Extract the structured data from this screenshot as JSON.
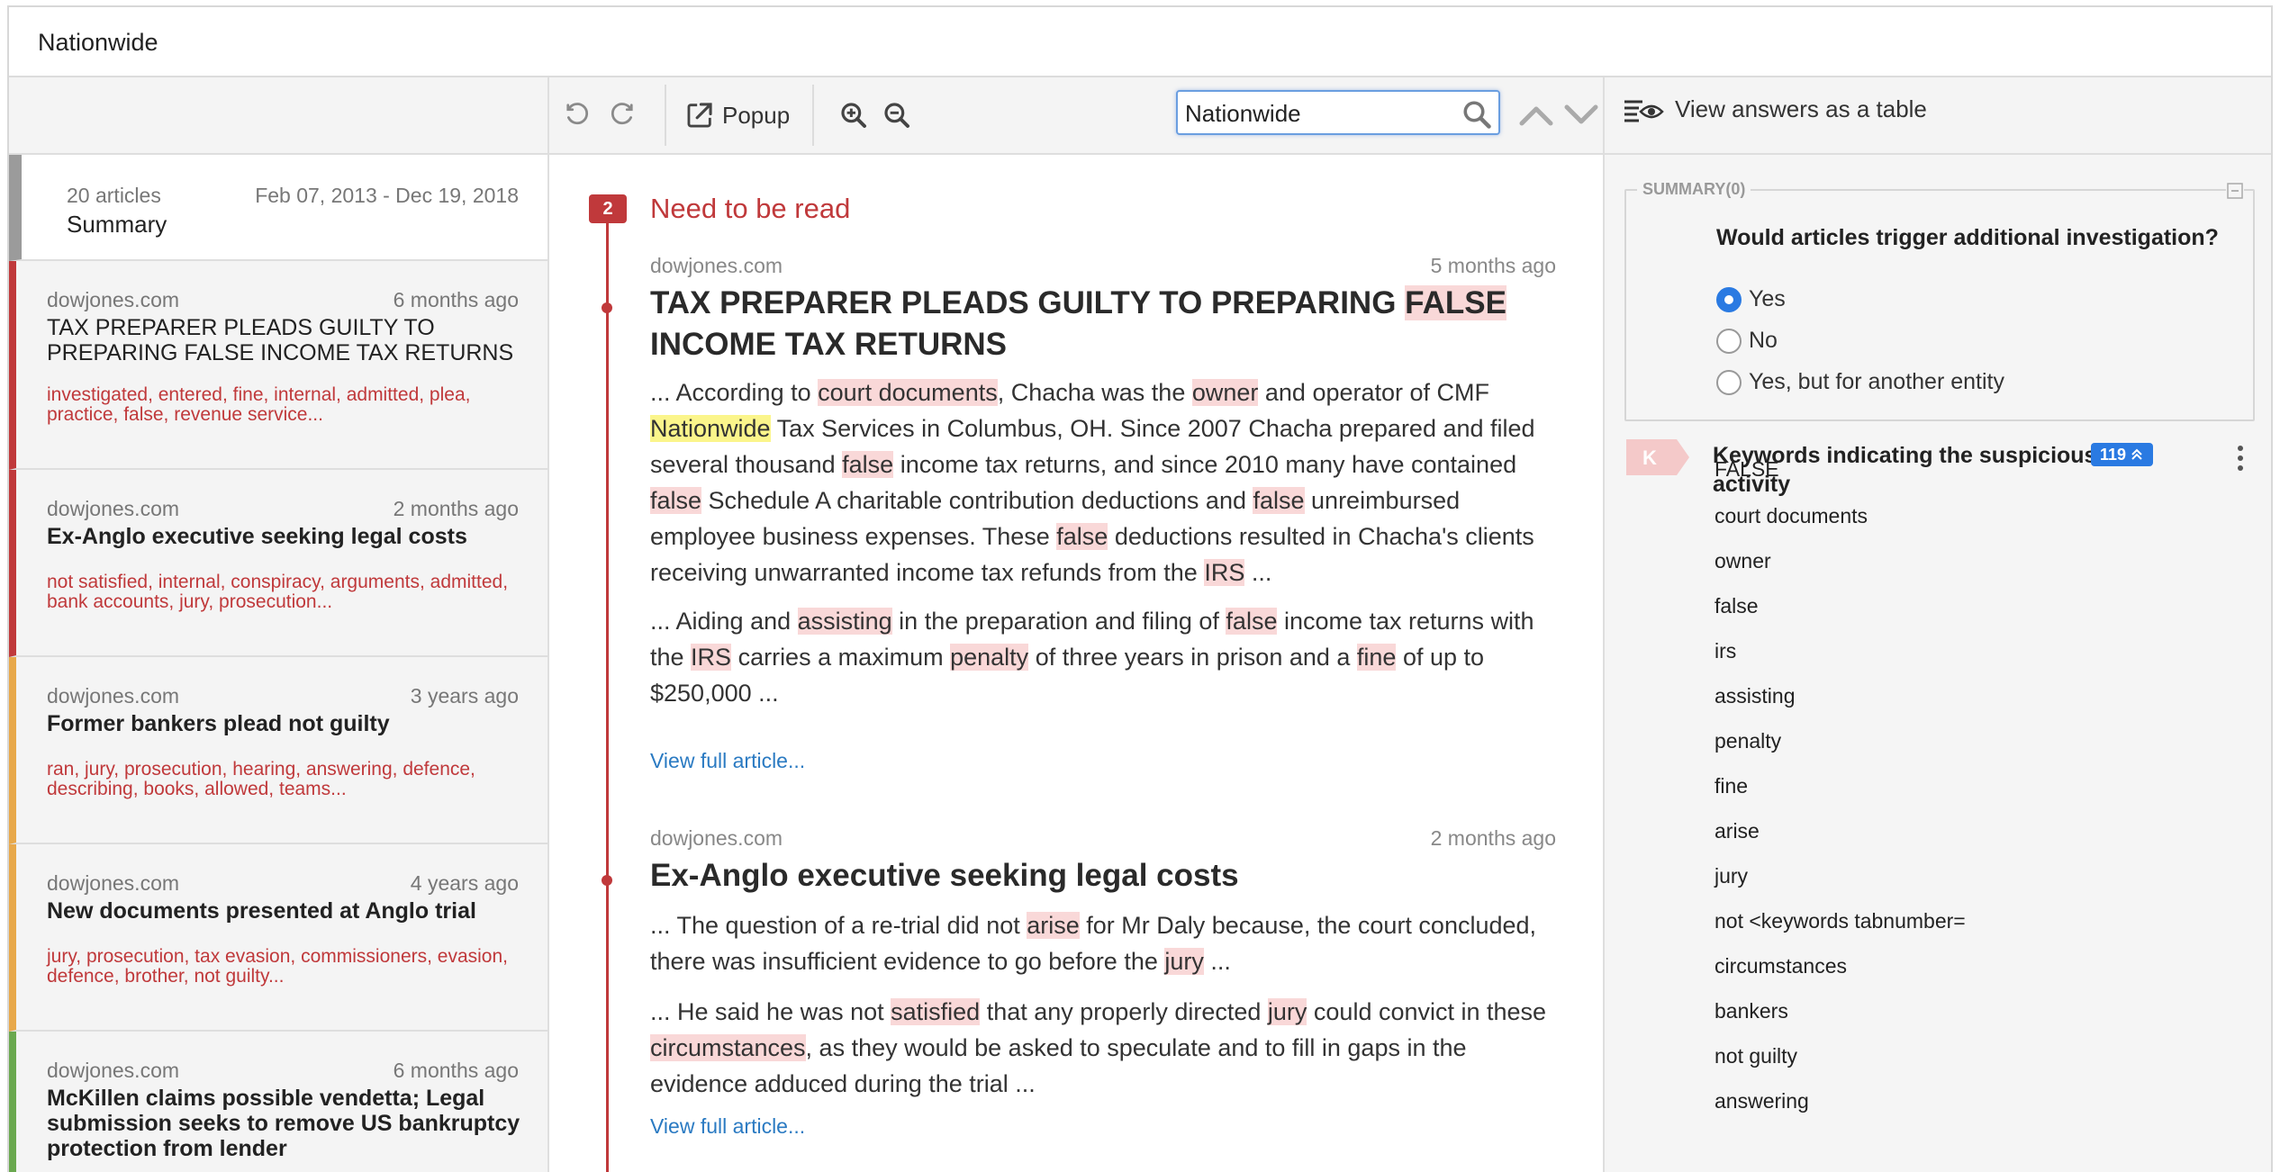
{
  "app": {
    "title": "Nationwide"
  },
  "toolbar": {
    "popup_label": "Popup",
    "search_value": "Nationwide",
    "view_table_label": "View answers as a table"
  },
  "summary": {
    "count": "20 articles",
    "range": "Feb 07, 2013 - Dec 19, 2018",
    "label": "Summary"
  },
  "articles_list": [
    {
      "source": "dowjones.com",
      "age": "6 months ago",
      "headline": "TAX PREPARER PLEADS GUILTY TO PREPARING FALSE INCOME TAX RETURNS",
      "keywords": "investigated, entered, fine, internal, admitted, plea, practice, false, revenue service...",
      "color": "#c0393b"
    },
    {
      "source": "dowjones.com",
      "age": "2 months ago",
      "headline": "Ex-Anglo executive seeking legal costs",
      "keywords": "not satisfied, internal, conspiracy, arguments, admitted, bank accounts, jury, prosecution...",
      "color": "#c0393b"
    },
    {
      "source": "dowjones.com",
      "age": "3 years ago",
      "headline": "Former bankers plead not guilty",
      "keywords": "ran, jury, prosecution, hearing, answering, defence, describing, books, allowed, teams...",
      "color": "#e8a84a"
    },
    {
      "source": "dowjones.com",
      "age": "4 years ago",
      "headline": "New documents presented at Anglo trial",
      "keywords": "jury, prosecution, tax evasion, commissioners, evasion, defence, brother, not guilty...",
      "color": "#e8a84a"
    },
    {
      "source": "dowjones.com",
      "age": "6 months ago",
      "headline": "McKillen claims possible vendetta; Legal submission seeks to remove US bankruptcy protection from lender",
      "keywords": "",
      "color": "#6aa84f"
    }
  ],
  "center": {
    "badge": "2",
    "section_label": "Need to be read",
    "articles": [
      {
        "source": "dowjones.com",
        "age": "5 months ago",
        "title_a": "TAX PREPARER PLEADS GUILTY TO PREPARING ",
        "title_hl": "FALSE",
        "title_b": " INCOME TAX RETURNS",
        "p1": [
          [
            "... According to ",
            ""
          ],
          [
            "court documents",
            "hl"
          ],
          [
            ", Chacha was the ",
            ""
          ],
          [
            "owner",
            "hl"
          ],
          [
            " and operator of CMF ",
            ""
          ],
          [
            "Nationwide",
            "hly"
          ],
          [
            " Tax Services in Columbus, OH. Since 2007 Chacha prepared and filed several thousand ",
            ""
          ],
          [
            "false",
            "hl"
          ],
          [
            " income tax returns, and since 2010 many have contained ",
            ""
          ],
          [
            "false",
            "hl"
          ],
          [
            " Schedule A charitable contribution deductions and ",
            ""
          ],
          [
            "false",
            "hl"
          ],
          [
            " unreimbursed employee business expenses. These ",
            ""
          ],
          [
            "false",
            "hl"
          ],
          [
            " deductions resulted in Chacha's clients receiving unwarranted income tax refunds from the ",
            ""
          ],
          [
            "IRS",
            "hl"
          ],
          [
            " ...",
            ""
          ]
        ],
        "p2": [
          [
            "... Aiding and ",
            ""
          ],
          [
            "assisting",
            "hl"
          ],
          [
            " in the preparation and filing of ",
            ""
          ],
          [
            "false",
            "hl"
          ],
          [
            " income tax returns with the ",
            ""
          ],
          [
            "IRS",
            "hl"
          ],
          [
            " carries a maximum ",
            ""
          ],
          [
            "penalty",
            "hl"
          ],
          [
            " of three years in prison and a ",
            ""
          ],
          [
            "fine",
            "hl"
          ],
          [
            " of up to $250,000 ...",
            ""
          ]
        ],
        "link": "View full article..."
      },
      {
        "source": "dowjones.com",
        "age": "2 months ago",
        "title_a": "Ex-Anglo executive seeking legal costs",
        "title_hl": "",
        "title_b": "",
        "p1": [
          [
            "... The question of a re-trial did not ",
            ""
          ],
          [
            "arise",
            "hl"
          ],
          [
            " for Mr Daly because, the court concluded, there was insufficient evidence to go before the ",
            ""
          ],
          [
            "jury",
            "hl"
          ],
          [
            " ...",
            ""
          ]
        ],
        "p2": [
          [
            "... He said he was not ",
            ""
          ],
          [
            "satisfied",
            "hl"
          ],
          [
            " that any properly directed ",
            ""
          ],
          [
            "jury",
            "hl"
          ],
          [
            " could convict in these ",
            ""
          ],
          [
            "circumstances",
            "hl"
          ],
          [
            ", as they would be asked to speculate and to fill in gaps in the evidence adduced during the trial ...",
            ""
          ]
        ],
        "link": "View full article..."
      }
    ]
  },
  "right": {
    "summary_legend": "SUMMARY(0)",
    "question": "Would articles trigger additional investigation?",
    "options": [
      "Yes",
      "No",
      "Yes, but for another entity"
    ],
    "selected_option": "Yes",
    "kw_tag": "K",
    "kw_title": "Keywords indicating the suspicious activity",
    "kw_count": "119",
    "keywords": [
      "FALSE",
      "court documents",
      "owner",
      "false",
      "irs",
      "assisting",
      "penalty",
      "fine",
      "arise",
      "jury",
      "not <keywords tabnumber=",
      "circumstances",
      "bankers",
      "not guilty",
      "answering"
    ]
  },
  "colors": {
    "accent_red": "#c0393b",
    "accent_blue": "#2a7ae2",
    "highlight_pink": "#f9d8d8",
    "highlight_yellow": "#fbf58b"
  }
}
